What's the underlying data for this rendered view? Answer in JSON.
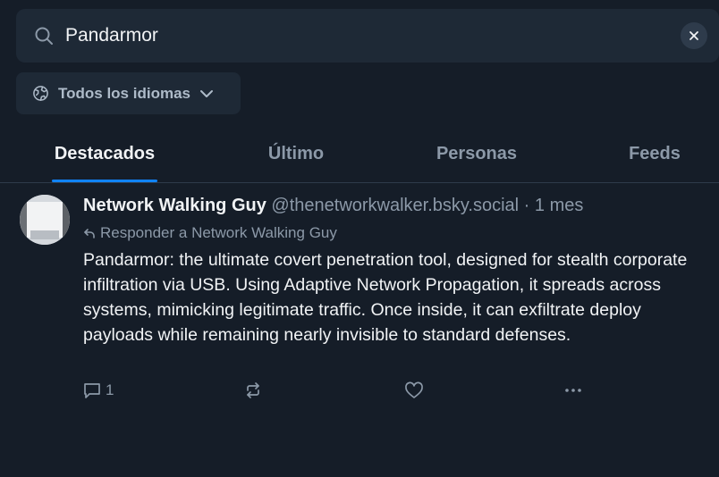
{
  "search": {
    "query": "Pandarmor",
    "placeholder": "Buscar"
  },
  "language_filter": {
    "label": "Todos los idiomas"
  },
  "tabs": [
    {
      "label": "Destacados",
      "active": true
    },
    {
      "label": "Último",
      "active": false
    },
    {
      "label": "Personas",
      "active": false
    },
    {
      "label": "Feeds",
      "active": false
    }
  ],
  "post": {
    "author_name": "Network Walking Guy",
    "handle": "@thenetworkwalker.bsky.social",
    "time": " · 1 mes",
    "reply_to": "Responder a Network Walking Guy",
    "text": "Pandarmor: the ultimate covert penetration tool, designed for stealth corporate infiltration via USB. Using Adaptive Network Propagation, it spreads across systems, mimicking legitimate traffic. Once inside, it can exfiltrate  deploy payloads while remaining nearly invisible to standard defenses.",
    "reply_count": "1"
  },
  "colors": {
    "background": "#151d28",
    "surface": "#1e2936",
    "accent": "#1083fe",
    "muted_text": "#8c99a8"
  },
  "icons": [
    "search-icon",
    "close-icon",
    "globe-icon",
    "chevron-down-icon",
    "reply-arrow-icon",
    "comment-icon",
    "repost-icon",
    "like-icon",
    "more-icon"
  ]
}
